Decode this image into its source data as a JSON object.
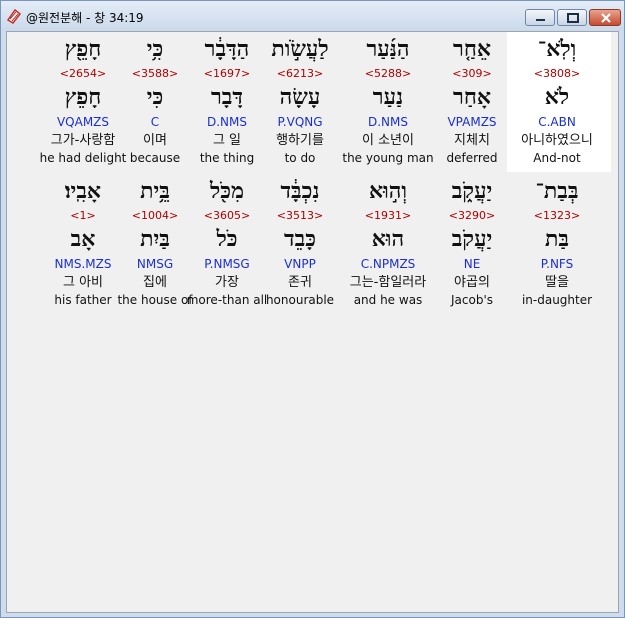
{
  "window": {
    "title": "@원전분해 - 창 34:19",
    "controls": {
      "minimize": "minimize-icon",
      "maximize": "maximize-icon",
      "close": "close-icon"
    }
  },
  "verse_rows": [
    {
      "words": [
        {
          "hebrew": "חָפֵ֖ץ",
          "strong": "<2654>",
          "lexeme": "חָפֵץ",
          "parse": "VQAMZS",
          "korean": "그가-사랑함",
          "english": "he had delight"
        },
        {
          "hebrew": "כִּ֥י",
          "strong": "<3588>",
          "lexeme": "כִּי",
          "parse": "C",
          "korean": "이며",
          "english": "because"
        },
        {
          "hebrew": "הַדָּבָ֔ר",
          "strong": "<1697>",
          "lexeme": "דָּבָר",
          "parse": "D.NMS",
          "korean": "그 일",
          "english": "the thing"
        },
        {
          "hebrew": "לַעֲשֹׂ֣ות",
          "strong": "<6213>",
          "lexeme": "עָשָׂה",
          "parse": "P.VQNG",
          "korean": "행하기를",
          "english": "to do"
        },
        {
          "hebrew": "הַנַּ֜עַר",
          "strong": "<5288>",
          "lexeme": "נַעַר",
          "parse": "D.NMS",
          "korean": "이 소년이",
          "english": "the young man"
        },
        {
          "hebrew": "אֵחַ֤ר",
          "strong": "<309>",
          "lexeme": "אָחַר",
          "parse": "VPAMZS",
          "korean": "지체치",
          "english": "deferred"
        },
        {
          "hebrew": "וְלֹֽא־",
          "strong": "<3808>",
          "lexeme": "לֹא",
          "parse": "C.ABN",
          "korean": "아니하였으니",
          "english": "And-not"
        }
      ]
    },
    {
      "words": [
        {
          "hebrew": "אָבִֽיו׃",
          "strong": "<1>",
          "lexeme": "אָב",
          "parse": "NMS.MZS",
          "korean": "그 아비",
          "english": "his father"
        },
        {
          "hebrew": "בֵּ֥ית",
          "strong": "<1004>",
          "lexeme": "בַּיִת",
          "parse": "NMSG",
          "korean": "집에",
          "english": "the house of"
        },
        {
          "hebrew": "מִכֹּ֖ל",
          "strong": "<3605>",
          "lexeme": "כֹּל",
          "parse": "P.NMSG",
          "korean": "가장",
          "english": "more-than all"
        },
        {
          "hebrew": "נִכְבָּ֔ד",
          "strong": "<3513>",
          "lexeme": "כָּבֵד",
          "parse": "VNPP",
          "korean": "존귀",
          "english": "honourable"
        },
        {
          "hebrew": "וְה֣וּא",
          "strong": "<1931>",
          "lexeme": "הוּא",
          "parse": "C.NPMZS",
          "korean": "그는-함일러라",
          "english": "and he was"
        },
        {
          "hebrew": "יַעֲקֹ֑ב",
          "strong": "<3290>",
          "lexeme": "יַעֲקֹב",
          "parse": "NE",
          "korean": "야곱의",
          "english": "Jacob's"
        },
        {
          "hebrew": "בְּבַת־",
          "strong": "<1323>",
          "lexeme": "בַּת",
          "parse": "P.NFS",
          "korean": "딸을",
          "english": "in-daughter"
        }
      ]
    }
  ]
}
